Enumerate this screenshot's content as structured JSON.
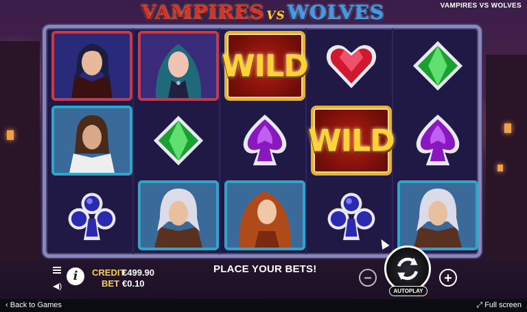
{
  "header": {
    "logo_vampires": "VAMPIRES",
    "logo_vs": "VS",
    "logo_wolves": "WOLVES",
    "game_name": "VAMPIRES VS WOLVES"
  },
  "grid": {
    "reels": 5,
    "rows": 3,
    "symbols": [
      [
        "vampire-man",
        "woman-vampire",
        "wild",
        "red-heart",
        "green-diamond"
      ],
      [
        "werewolf-man",
        "green-diamond",
        "purple-spade",
        "wild",
        "purple-spade"
      ],
      [
        "blue-club",
        "white-hair-man",
        "red-hair-woman",
        "blue-club",
        "white-hair-man"
      ]
    ],
    "wild_label": "WILD"
  },
  "controls": {
    "credit_label": "CREDIT",
    "credit_value": "€499.90",
    "bet_label": "BET",
    "bet_value": "€0.10",
    "status_text": "PLACE YOUR BETS!",
    "autoplay_label": "AUTOPLAY",
    "minus_label": "−",
    "plus_label": "+",
    "info_label": "i"
  },
  "footer": {
    "back_label": "Back to Games",
    "fullscreen_label": "Full screen"
  },
  "colors": {
    "vampire_frame": "#c83a4a",
    "wolf_frame": "#2fa6c9",
    "wild_gold": "#ffd23a",
    "credit_label": "#ffd23a"
  }
}
